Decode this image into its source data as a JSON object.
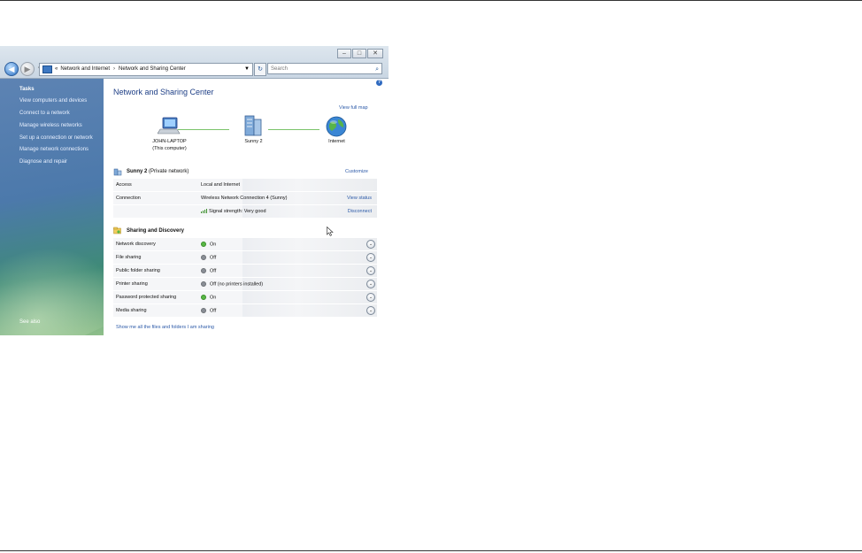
{
  "window": {
    "caption_buttons": [
      "‒",
      "□",
      "✕"
    ],
    "address": {
      "chevron": "«",
      "crumbs": [
        "Network and Internet",
        "Network and Sharing Center"
      ],
      "separator": "›"
    },
    "search_placeholder": "Search"
  },
  "sidebar": {
    "tasks_heading": "Tasks",
    "items": [
      "View computers and devices",
      "Connect to a network",
      "Manage wireless networks",
      "Set up a connection or network",
      "Manage network connections",
      "Diagnose and repair"
    ],
    "see_also": "See also"
  },
  "content": {
    "help": "?",
    "title": "Network and Sharing Center",
    "view_full_map": "View full map",
    "map": {
      "computer_name": "JOHN-LAPTOP",
      "computer_sub": "(This computer)",
      "network_name": "Sunny 2",
      "internet": "Internet"
    },
    "network": {
      "name": "Sunny 2",
      "type": "(Private network)",
      "customize": "Customize",
      "rows": [
        {
          "label": "Access",
          "value": "Local and Internet",
          "link": ""
        },
        {
          "label": "Connection",
          "value": "Wireless Network Connection 4 (Sunny)",
          "link": "View status"
        },
        {
          "label": "",
          "value": "Signal strength:  Very good",
          "link": "Disconnect"
        }
      ]
    },
    "sharing": {
      "heading": "Sharing and Discovery",
      "rows": [
        {
          "label": "Network discovery",
          "state": "On",
          "status": "on"
        },
        {
          "label": "File sharing",
          "state": "Off",
          "status": "off"
        },
        {
          "label": "Public folder sharing",
          "state": "Off",
          "status": "off"
        },
        {
          "label": "Printer sharing",
          "state": "Off (no printers installed)",
          "status": "off"
        },
        {
          "label": "Password protected sharing",
          "state": "On",
          "status": "on"
        },
        {
          "label": "Media sharing",
          "state": "Off",
          "status": "off"
        }
      ]
    },
    "bottom_link": "Show me all the files and folders I am sharing"
  },
  "colors": {
    "link": "#2c5aa8",
    "title": "#1e3f86",
    "on_dot": "#58b845",
    "off_dot": "#8a8f96",
    "map_line": "#7bc36b"
  }
}
